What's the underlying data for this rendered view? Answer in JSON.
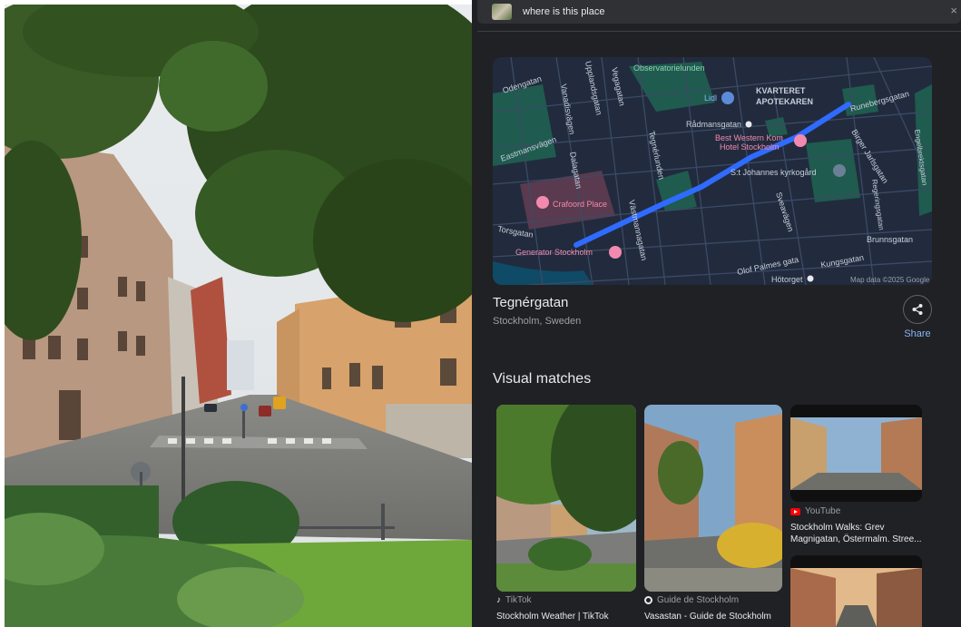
{
  "search": {
    "query": "where is this place",
    "close_glyph": "×"
  },
  "map": {
    "labels": {
      "observatorielunden": "Observatorielunden",
      "odengatan": "Odengatan",
      "vanadisvagen": "Vanadisvägen",
      "upplandsgatan": "Upplandsgatan",
      "vegagatan": "Vegagatan",
      "lidl": "Lidl",
      "kvarteret1": "KVARTERET",
      "kvarteret2": "APOTEKAREN",
      "runebergsgatan": "Runebergsgatan",
      "radmansgatan": "Rådmansgatan",
      "birger": "Birger Jarlsgatan",
      "eastmansvagen": "Eastmansvägen",
      "bestwestern1": "Best Western Kom",
      "bestwestern2": "Hotel Stockholm",
      "engelbrekts": "Engelbrektsgatan",
      "tegnerlunden": "Tegnérlunden",
      "dalagatan": "Dalagatan",
      "sjohannes": "S:t Johannes kyrkogård",
      "crafoord": "Crafoord Place",
      "vastmannagatan": "Västmannagatan",
      "regeringsgatan": "Regeringsgatan",
      "sveavagen": "Sveavägen",
      "torsgatan": "Torsgatan",
      "brunnsgatan": "Brunnsgatan",
      "generator": "Generator Stockholm",
      "olofpalmes": "Olof Palmes gata",
      "kungsgatan": "Kungsgatan",
      "hotorget": "Hötorget",
      "attribution": "Map data ©2025 Google"
    }
  },
  "place": {
    "name": "Tegnérgatan",
    "location": "Stockholm, Sweden",
    "share_label": "Share"
  },
  "visual_matches": {
    "heading": "Visual matches",
    "cards": [
      {
        "source": "TikTok",
        "title": "Stockholm Weather | TikTok"
      },
      {
        "source": "Guide de Stockholm",
        "title": "Vasastan - Guide de Stockholm"
      },
      {
        "source": "YouTube",
        "title": "Stockholm Walks: Grev Magnigatan, Östermalm. Stree..."
      },
      {
        "source": "",
        "title": ""
      }
    ]
  },
  "colors": {
    "panel_bg": "#202124",
    "route": "#2f6bff",
    "link": "#8ab4f8",
    "map_bg": "#212b3d",
    "park": "#1f5b4e"
  }
}
